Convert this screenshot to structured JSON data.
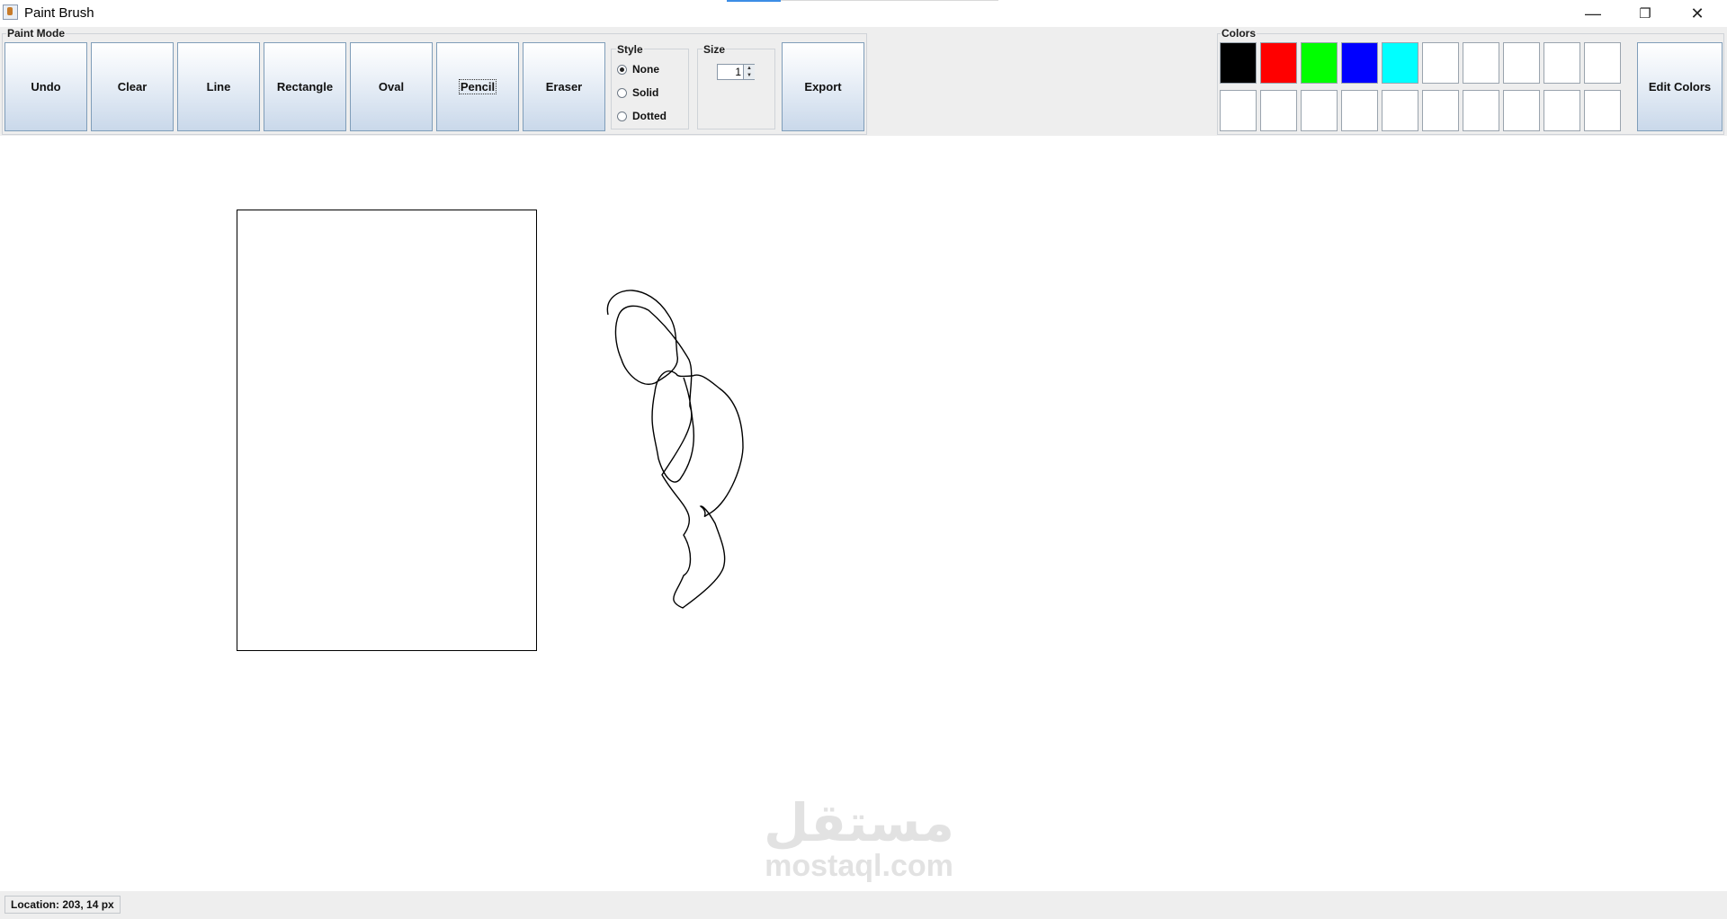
{
  "window": {
    "title": "Paint Brush",
    "controls": {
      "minimize": "—",
      "restore": "❐",
      "close": "✕"
    }
  },
  "paint_mode": {
    "title": "Paint Mode",
    "buttons": [
      "Undo",
      "Clear",
      "Line",
      "Rectangle",
      "Oval",
      "Pencil",
      "Eraser"
    ],
    "focused": "Pencil"
  },
  "style": {
    "title": "Style",
    "options": [
      "None",
      "Solid",
      "Dotted"
    ],
    "selected": "None"
  },
  "size": {
    "title": "Size",
    "value": "1"
  },
  "export_label": "Export",
  "colors": {
    "title": "Colors",
    "row1": [
      "#000000",
      "#ff0000",
      "#00ff00",
      "#0000ff",
      "#00ffff",
      "#ffffff",
      "#ffffff",
      "#ffffff",
      "#ffffff",
      "#ffffff"
    ],
    "row2": [
      "#ffffff",
      "#ffffff",
      "#ffffff",
      "#ffffff",
      "#ffffff",
      "#ffffff",
      "#ffffff",
      "#ffffff",
      "#ffffff",
      "#ffffff"
    ],
    "edit_label": "Edit Colors"
  },
  "watermark": {
    "arabic": "مستقل",
    "latin": "mostaql.com"
  },
  "status": {
    "location": "Location: 203, 14 px"
  }
}
